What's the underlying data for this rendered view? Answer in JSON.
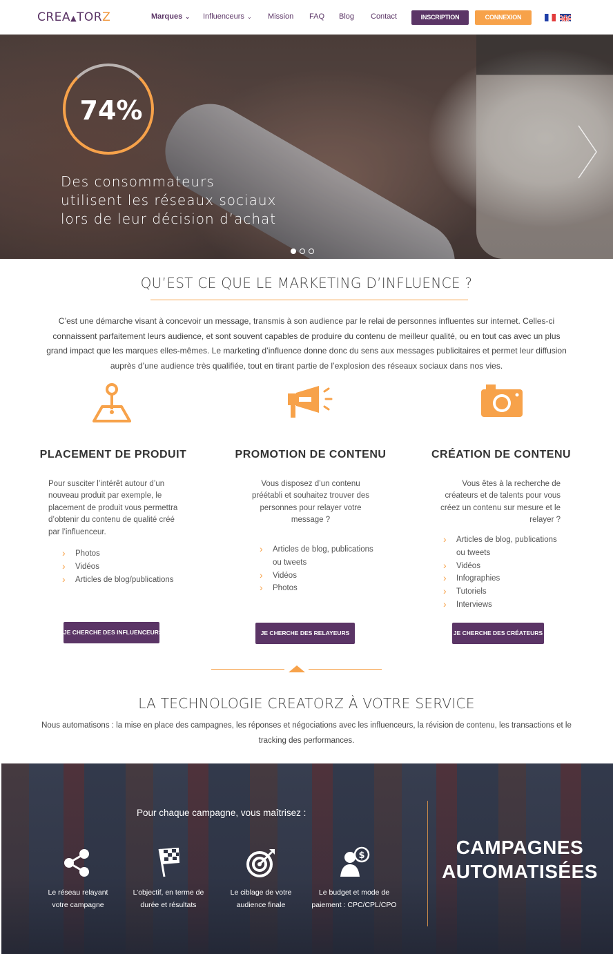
{
  "nav": {
    "logo": {
      "part1": "CREA",
      "tri": "▲",
      "part2": "TOR",
      "part3": "Z"
    },
    "items": [
      {
        "label": "Marques",
        "has_dropdown": true
      },
      {
        "label": "Influenceurs",
        "has_dropdown": true
      },
      {
        "label": "Mission"
      },
      {
        "label": "FAQ"
      },
      {
        "label": "Blog"
      },
      {
        "label": "Contact"
      }
    ],
    "inscription": "INSCRIPTION",
    "connexion": "CONNEXION",
    "chevron": "⌄"
  },
  "hero": {
    "percent": "74%",
    "line1": "Des consommateurs",
    "line2": "utilisent les réseaux sociaux",
    "line3": "lors de leur décision d’achat",
    "active_slide": 1,
    "slide_count": 3
  },
  "intro": {
    "title": "QU’EST CE QUE LE MARKETING D’INFLUENCE ?",
    "text": "C’est une démarche visant à concevoir un message, transmis à son audience par le relai de personnes influentes sur internet. Celles-ci connaissent parfaitement leurs audience, et sont souvent capables de produire du contenu de meilleur qualité, ou en tout cas avec un plus grand impact que les marques elles-mêmes.  Le marketing d’influence donne donc du sens aux messages publicitaires et permet leur diffusion auprès d’une audience très qualifiée, tout en tirant partie de l’explosion des réseaux sociaux dans nos vies."
  },
  "columns": [
    {
      "icon": "map-pin-icon",
      "title": "PLACEMENT DE PRODUIT",
      "desc": "Pour susciter l’intérêt autour d’un nouveau produit par exemple, le placement de produit vous permettra d’obtenir du contenu de qualité créé par l’influenceur.",
      "items": [
        "Photos",
        "Vidéos",
        "Articles de blog/publications"
      ],
      "button": "JE CHERCHE DES INFLUENCEURS"
    },
    {
      "icon": "megaphone-icon",
      "title": "PROMOTION DE CONTENU",
      "desc": "Vous disposez d’un contenu préétabli et souhaitez trouver des personnes pour relayer votre message ?",
      "items": [
        "Articles de blog, publications ou tweets",
        "Vidéos",
        "Photos"
      ],
      "button": "JE CHERCHE DES RELAYEURS"
    },
    {
      "icon": "camera-icon",
      "title": "CRÉATION DE CONTENU",
      "desc": "Vous êtes à la recherche de créateurs et de talents pour vous créez un contenu sur mesure et le relayer ?",
      "items": [
        "Articles de blog, publications ou tweets",
        "Vidéos",
        "Infographies",
        "Tutoriels",
        "Interviews"
      ],
      "button": "JE CHERCHE DES CRÉATEURS"
    }
  ],
  "tech": {
    "title": "LA TECHNOLOGIE CREATORZ À VOTRE SERVICE",
    "text": "Nous automatisons : la mise en place des campagnes, les réponses et négociations avec les influenceurs, la révision de contenu, les transactions et le tracking des performances."
  },
  "campaign": {
    "intro": "Pour chaque campagne, vous maîtrisez :",
    "features": [
      {
        "icon": "share-icon",
        "label": "Le réseau relayant votre campagne"
      },
      {
        "icon": "checkered-flag-icon",
        "label": "L’objectif, en terme de durée et résultats"
      },
      {
        "icon": "target-icon",
        "label": "Le ciblage de votre audience finale"
      },
      {
        "icon": "budget-user-icon",
        "label": "Le budget et mode de paiement : CPC/CPL/CPO"
      }
    ],
    "title_line1": "CAMPAGNES",
    "title_line2": "AUTOMATISÉES"
  },
  "colors": {
    "purple": "#5b3566",
    "orange": "#f7a24a"
  }
}
